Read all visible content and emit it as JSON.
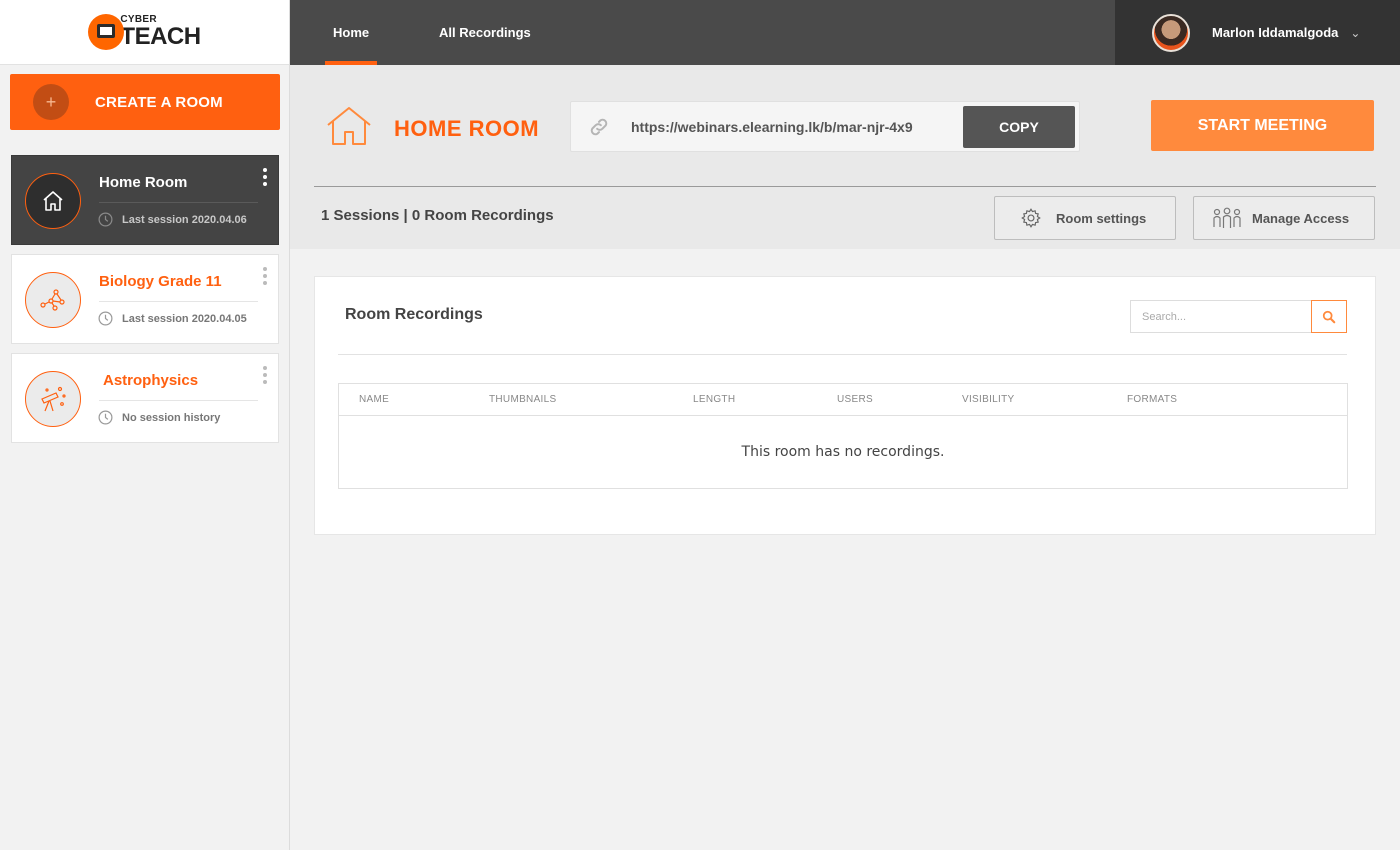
{
  "brand": {
    "logo_small": "CYBER",
    "logo_big": "TEACH",
    "accent_color": "#ff6010"
  },
  "sidebar": {
    "create_room_label": "CREATE A ROOM",
    "rooms": [
      {
        "title": "Home Room",
        "meta": "Last session 2020.04.06",
        "icon": "home-icon",
        "active": true
      },
      {
        "title": "Biology Grade 11",
        "meta": "Last session 2020.04.05",
        "icon": "molecule-icon",
        "active": false
      },
      {
        "title": "Astrophysics",
        "meta": "No session history",
        "icon": "telescope-icon",
        "active": false
      }
    ]
  },
  "topbar": {
    "tabs": [
      {
        "label": "Home",
        "active": true
      },
      {
        "label": "All Recordings",
        "active": false
      }
    ],
    "user_name": "Marlon Iddamalgoda"
  },
  "room_header": {
    "heading": "HOME ROOM",
    "url": "https://webinars.elearning.lk/b/mar-njr-4x9",
    "copy_label": "COPY",
    "start_label": "START MEETING",
    "sessions_text": "1 Sessions | 0 Room Recordings",
    "room_settings_label": "Room settings",
    "manage_access_label": "Manage Access"
  },
  "recordings": {
    "title": "Room Recordings",
    "search_placeholder": "Search...",
    "columns": [
      "NAME",
      "THUMBNAILS",
      "LENGTH",
      "USERS",
      "VISIBILITY",
      "FORMATS"
    ],
    "empty_message": "This room has no recordings."
  }
}
